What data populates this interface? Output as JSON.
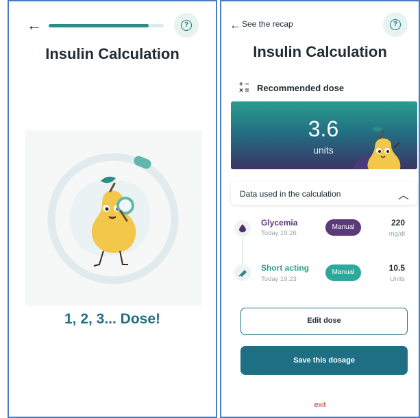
{
  "left_screen": {
    "back_icon": "arrow-left-icon",
    "help_icon": "question-circle-icon",
    "progress_fraction": 0.87,
    "title": "Insulin Calculation",
    "loading_text": "1, 2, 3... Dose!",
    "colors": {
      "accent": "#2a8d87",
      "title_teal": "#1e6f84"
    }
  },
  "right_screen": {
    "recap_link": "See the recap",
    "help_icon": "question-circle-icon",
    "title": "Insulin Calculation",
    "recommended_label": "Recommended dose",
    "calc_icon": "calculator-operators-icon",
    "dose": {
      "value": "3.6",
      "unit": "units"
    },
    "data_panel": {
      "label": "Data used in the calculation",
      "chevron": "chevron-up-icon"
    },
    "entries": [
      {
        "icon": "drop-icon",
        "name": "Glycemia",
        "time": "Today 19:26",
        "badge": "Manual",
        "value": "220",
        "unit": "mg/dl",
        "name_color": "#5b3a7a",
        "badge_color": "#5b3a7a"
      },
      {
        "icon": "syringe-icon",
        "name": "Short acting",
        "time": "Today 19:23",
        "badge": "Manual",
        "value": "10.5",
        "unit": "Units",
        "name_color": "#2a9d8e",
        "badge_color": "#2fa79a"
      }
    ],
    "edit_button": "Edit dose",
    "save_button": "Save this dosage",
    "exit_link": "exit"
  }
}
